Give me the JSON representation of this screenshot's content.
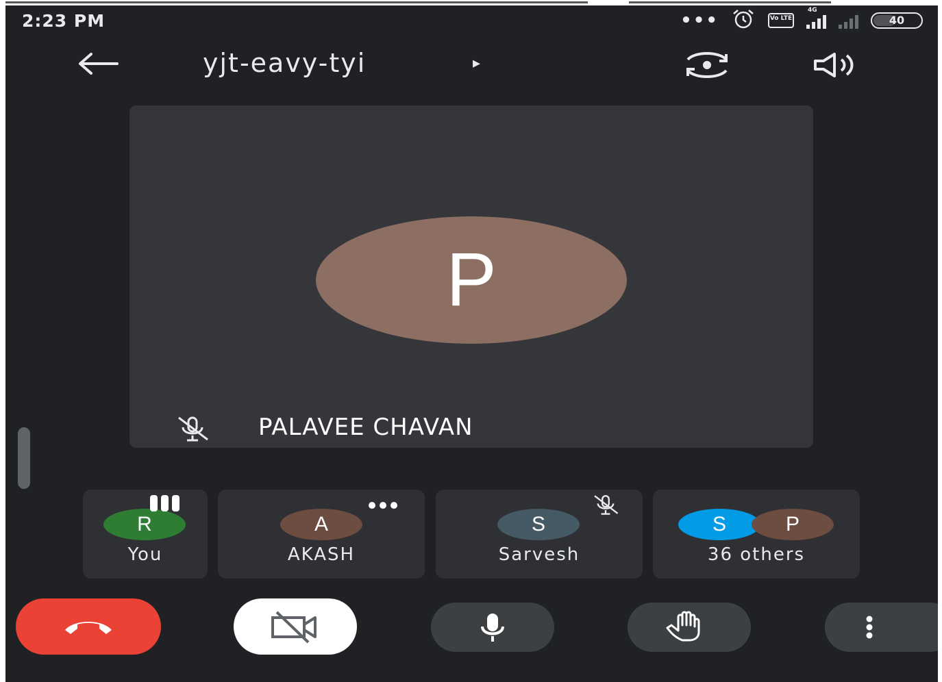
{
  "status_bar": {
    "time": "2:23 PM",
    "network_label_top": "4G",
    "volte_label": "Vo LTE",
    "battery": "40",
    "icons": [
      "more-dots-icon",
      "alarm-icon",
      "volte-icon",
      "signal-4g-icon",
      "signal-no-service-icon",
      "battery-icon"
    ]
  },
  "toolbar": {
    "meeting_code": "yjt-eavy-tyi",
    "caret": "▸",
    "icons": [
      "back-arrow-icon",
      "switch-camera-icon",
      "speaker-icon"
    ]
  },
  "main_speaker": {
    "initial": "P",
    "name": "PALAVEE CHAVAN",
    "avatar_color": "#8d6e63",
    "muted": true
  },
  "participants": [
    {
      "initial": "R",
      "name": "You",
      "color": "#2e7d32",
      "indicator": "speaking-bars"
    },
    {
      "initial": "A",
      "name": "AKASH",
      "color": "#6d4c41",
      "indicator": "more-dots"
    },
    {
      "initial": "S",
      "name": "Sarvesh",
      "color": "#455a64",
      "indicator": "muted"
    }
  ],
  "others": {
    "initials": [
      "S",
      "P"
    ],
    "colors": [
      "#039be5",
      "#6d4c41"
    ],
    "label": "36 others"
  },
  "controls": {
    "end_call_color": "#ea4335",
    "icons": [
      "end-call-icon",
      "camera-off-icon",
      "microphone-icon",
      "raise-hand-icon",
      "more-vert-icon"
    ]
  }
}
